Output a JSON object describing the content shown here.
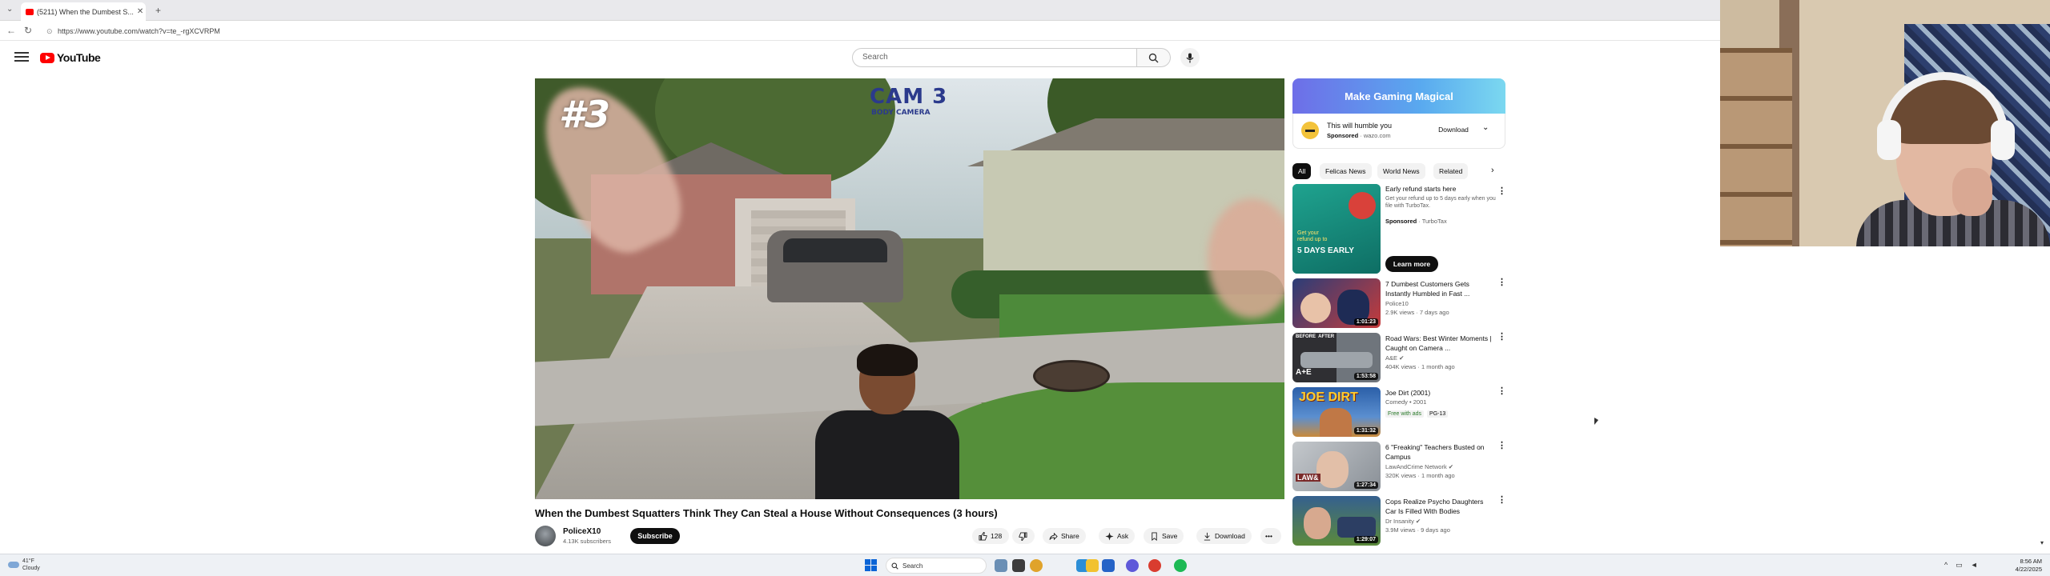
{
  "browser": {
    "tab_title": "(5211) When the Dumbest S...",
    "tab_close": "✕",
    "new_tab": "+",
    "tab_list": "⌄",
    "url": "https://www.youtube.com/watch?v=te_-rgXCVRPM",
    "back": "←",
    "refresh": "↻"
  },
  "youtube": {
    "logo_text": "YouTube",
    "search_placeholder": "Search"
  },
  "player": {
    "overlay_number": "#3",
    "overlay_cam": "CAM 3",
    "overlay_cam_sub": "BODY CAMERA"
  },
  "video": {
    "title": "When the Dumbest Squatters Think They Can Steal a House Without Consequences (3 hours)",
    "channel": "PoliceX10",
    "subscribers": "4.13K subscribers",
    "subscribe_label": "Subscribe",
    "likes": "128",
    "share_label": "Share",
    "ask_label": "Ask",
    "save_label": "Save",
    "download_label": "Download",
    "more_label": "•••"
  },
  "ad": {
    "banner_text": "Make Gaming Magical",
    "title": "This will humble you",
    "sponsored": "Sponsored",
    "domain": "· wazo.com",
    "download_label": "Download",
    "chevron": "⌄"
  },
  "chips": [
    "All",
    "Felicas News",
    "World News",
    "Related"
  ],
  "chip_next": "›",
  "ad_rec": {
    "title": "Early refund starts here",
    "desc": "Get your refund up to 5 days early when you file with TurboTax.",
    "sponsored": "Sponsored",
    "advertiser": "· TurboTax",
    "thumb_line1": "Get your",
    "thumb_line2": "refund up to",
    "thumb_big": "5 DAYS EARLY",
    "learn_more": "Learn more"
  },
  "recommendations": [
    {
      "title": "7 Dumbest Customers Gets Instantly Humbled in Fast ...",
      "channel": "Police10",
      "meta": "2.9K views · 7 days ago",
      "duration": "1:01:23",
      "colors": [
        "#2a3d78",
        "#c63b3b"
      ]
    },
    {
      "title": "Road Wars: Best Winter Moments | Caught on Camera ...",
      "channel": "A&E ✔",
      "meta": "404K views · 1 month ago",
      "duration": "1:53:58",
      "colors": [
        "#3b3b3b",
        "#8a8f96"
      ],
      "thumb_tag": "BEFORE  AFTER"
    },
    {
      "title": "Joe Dirt (2001)",
      "channel": "Comedy • 2001",
      "meta": "",
      "duration": "1:31:32",
      "colors": [
        "#2b5fa8",
        "#e0a03a"
      ],
      "thumb_text": "JOE DIRT",
      "badges": [
        "Free with ads",
        "PG-13"
      ]
    },
    {
      "title": "6 \"Freaking\" Teachers Busted on Campus",
      "channel": "LawAndCrime Network ✔",
      "meta": "320K views · 1 month ago",
      "duration": "1:27:34",
      "colors": [
        "#b5b9be",
        "#7a2a2a"
      ]
    },
    {
      "title": "Cops Realize Psycho Daughters Car Is Filled With Bodies",
      "channel": "Dr Insanity ✔",
      "meta": "3.9M views · 9 days ago",
      "duration": "1:29:07",
      "colors": [
        "#35608f",
        "#5b8a3a"
      ]
    }
  ],
  "taskbar": {
    "weather_temp": "41°F",
    "weather_desc": "Cloudy",
    "search_label": "Search",
    "time": "8:56 AM",
    "date": "4/22/2025"
  }
}
